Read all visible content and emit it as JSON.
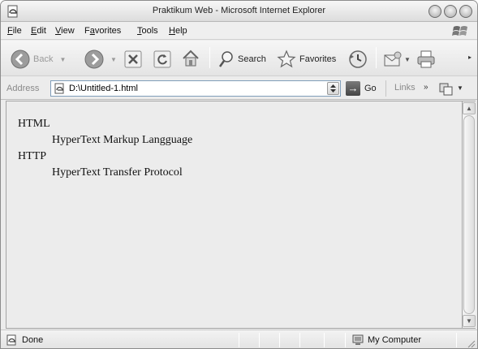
{
  "window": {
    "title": "Praktikum Web - Microsoft Internet Explorer"
  },
  "menu": {
    "items": [
      {
        "label": "File",
        "key": "F"
      },
      {
        "label": "Edit",
        "key": "E"
      },
      {
        "label": "View",
        "key": "V"
      },
      {
        "label": "Favorites",
        "key": "a"
      },
      {
        "label": "Tools",
        "key": "T"
      },
      {
        "label": "Help",
        "key": "H"
      }
    ]
  },
  "toolbar": {
    "back_label": "Back",
    "search_label": "Search",
    "favorites_label": "Favorites"
  },
  "address": {
    "label": "Address",
    "value": "D:\\Untitled-1.html",
    "go_label": "Go",
    "links_label": "Links"
  },
  "content": {
    "definitions": [
      {
        "term": "HTML",
        "description": "HyperText Markup Langguage"
      },
      {
        "term": "HTTP",
        "description": "HyperText Transfer Protocol"
      }
    ]
  },
  "status": {
    "text": "Done",
    "zone": "My Computer"
  }
}
